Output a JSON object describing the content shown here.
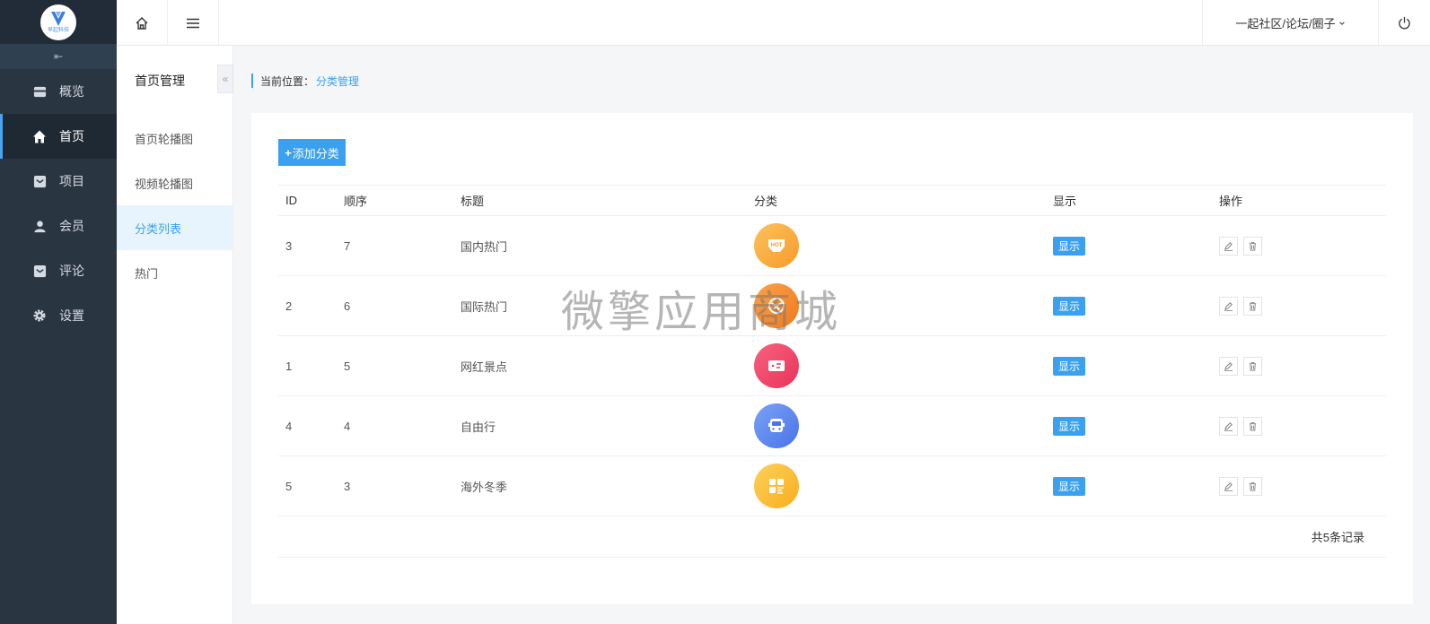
{
  "logo": {
    "text": "早起科技"
  },
  "sidebar": {
    "items": [
      {
        "label": "概览",
        "icon": "overview-icon"
      },
      {
        "label": "首页",
        "icon": "home-icon",
        "active": true
      },
      {
        "label": "项目",
        "icon": "project-icon"
      },
      {
        "label": "会员",
        "icon": "member-icon"
      },
      {
        "label": "评论",
        "icon": "comment-icon"
      },
      {
        "label": "设置",
        "icon": "gear-icon"
      }
    ]
  },
  "topbar": {
    "community": "一起社区/论坛/圈子"
  },
  "submenu": {
    "title": "首页管理",
    "items": [
      {
        "label": "首页轮播图"
      },
      {
        "label": "视频轮播图"
      },
      {
        "label": "分类列表",
        "active": true
      },
      {
        "label": "热门"
      }
    ]
  },
  "breadcrumb": {
    "prefix": "当前位置：",
    "current": "分类管理"
  },
  "toolbar": {
    "add_label": "添加分类"
  },
  "table": {
    "headers": {
      "id": "ID",
      "order": "顺序",
      "title": "标题",
      "category": "分类",
      "show": "显示",
      "ops": "操作"
    },
    "rows": [
      {
        "id": "3",
        "order": "7",
        "title": "国内热门",
        "icon_color": "#fbab3f",
        "icon": "hot-icon",
        "show": "显示"
      },
      {
        "id": "2",
        "order": "6",
        "title": "国际热门",
        "icon_color": "#f5882a",
        "icon": "globe-icon",
        "show": "显示"
      },
      {
        "id": "1",
        "order": "5",
        "title": "网红景点",
        "icon_color": "#f0486b",
        "icon": "ticket-icon",
        "show": "显示"
      },
      {
        "id": "4",
        "order": "4",
        "title": "自由行",
        "icon_color": "#5b86f2",
        "icon": "bus-icon",
        "show": "显示"
      },
      {
        "id": "5",
        "order": "3",
        "title": "海外冬季",
        "icon_color": "#fbbc2c",
        "icon": "grid-icon",
        "show": "显示"
      }
    ],
    "total": "共5条记录"
  },
  "watermark": "微擎应用商城",
  "colors": {
    "accent": "#3aa1f0",
    "sidebar_bg": "#2a3542"
  }
}
